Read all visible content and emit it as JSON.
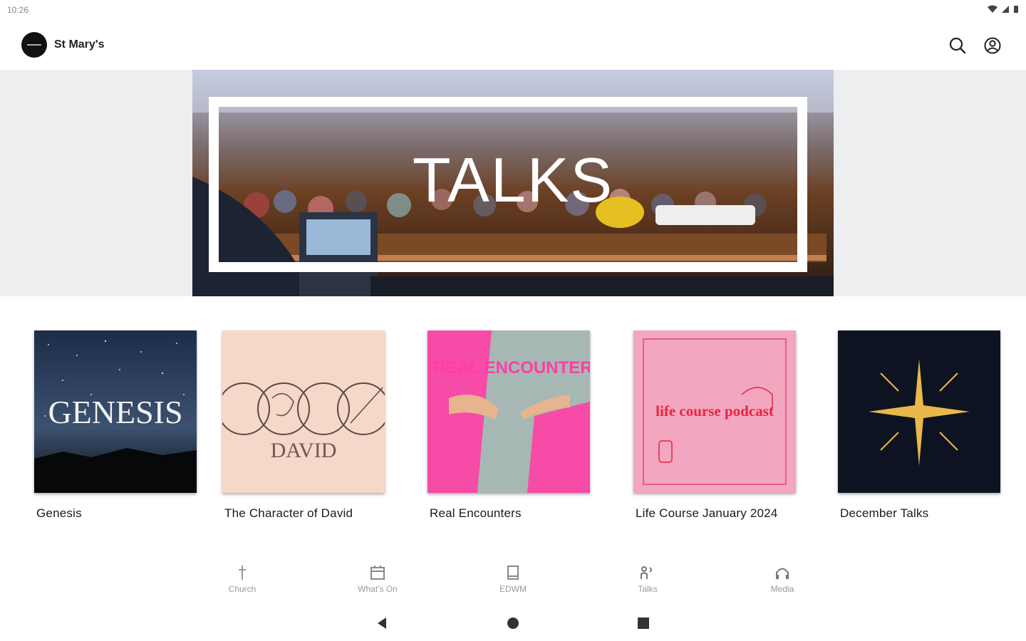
{
  "status_bar": {
    "time": "10:26"
  },
  "app_bar": {
    "title": "St Mary's"
  },
  "hero": {
    "title": "TALKS"
  },
  "series": [
    {
      "title": "Genesis",
      "art_text": "GENESIS"
    },
    {
      "title": "The Character of David",
      "art_text": "DAVID"
    },
    {
      "title": "Real Encounters",
      "art_text": "REAL ENCOUNTERS"
    },
    {
      "title": "Life Course January 2024",
      "art_text": "life course podcast"
    },
    {
      "title": "December Talks",
      "art_text": ""
    }
  ],
  "bottom_nav": {
    "items": [
      {
        "label": "Church",
        "icon": "cross-icon"
      },
      {
        "label": "What's On",
        "icon": "calendar-icon"
      },
      {
        "label": "EDWM",
        "icon": "book-icon"
      },
      {
        "label": "Talks",
        "icon": "speaker-icon"
      },
      {
        "label": "Media",
        "icon": "headphones-icon"
      }
    ]
  },
  "colors": {
    "accent_pink": "#ff3fa4",
    "pink_bg": "#f3a6bf",
    "beige": "#f6d8c8",
    "navy": "#0d1320"
  }
}
